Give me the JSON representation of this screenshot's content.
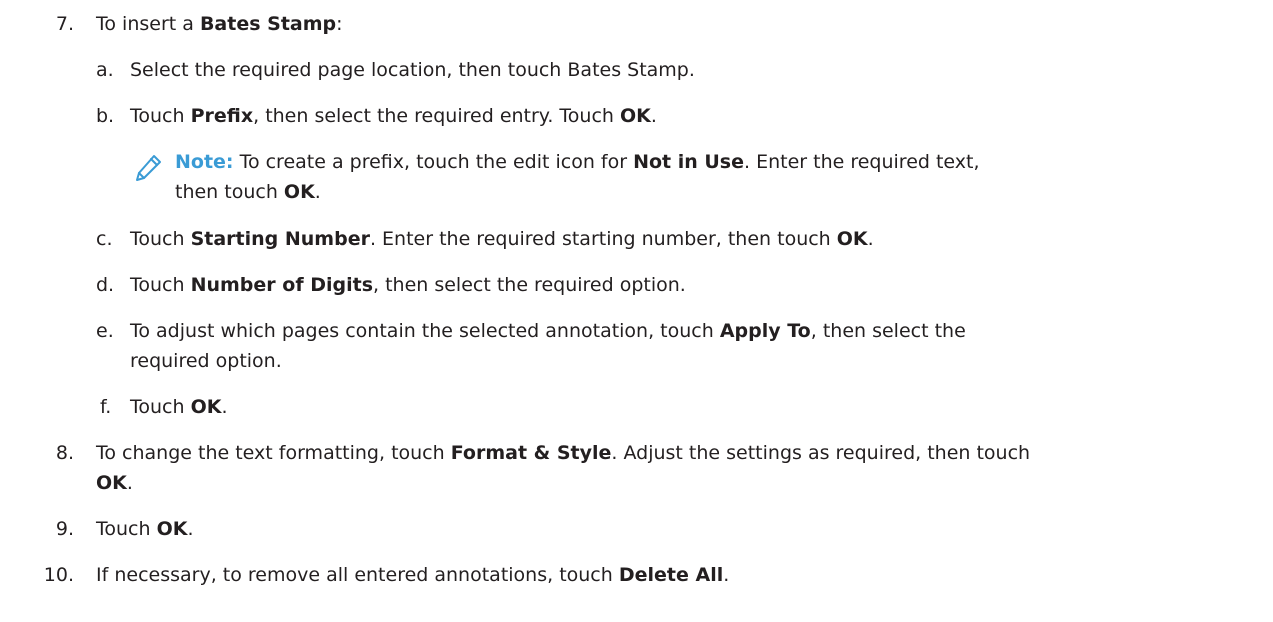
{
  "steps": [
    {
      "number": "7.",
      "text": [
        {
          "t": "To insert a ",
          "b": false
        },
        {
          "t": "Bates Stamp",
          "b": true
        },
        {
          "t": ":",
          "b": false
        }
      ],
      "substeps": [
        {
          "letter": "a.",
          "lines": [
            [
              {
                "t": "Select the required page location, then touch Bates Stamp.",
                "b": false
              }
            ]
          ]
        },
        {
          "letter": "b.",
          "lines": [
            [
              {
                "t": "Touch ",
                "b": false
              },
              {
                "t": "Prefix",
                "b": true
              },
              {
                "t": ", then select the required entry. Touch ",
                "b": false
              },
              {
                "t": "OK",
                "b": true
              },
              {
                "t": ".",
                "b": false
              }
            ]
          ],
          "note": {
            "icon": "pencil-icon",
            "label": "Note:",
            "lines": [
              [
                {
                  "t": " To create a prefix, touch the edit icon for ",
                  "b": false
                },
                {
                  "t": "Not in Use",
                  "b": true
                },
                {
                  "t": ". Enter the required text,",
                  "b": false
                }
              ],
              [
                {
                  "t": "then touch ",
                  "b": false
                },
                {
                  "t": "OK",
                  "b": true
                },
                {
                  "t": ".",
                  "b": false
                }
              ]
            ]
          }
        },
        {
          "letter": "c.",
          "lines": [
            [
              {
                "t": "Touch ",
                "b": false
              },
              {
                "t": "Starting Number",
                "b": true
              },
              {
                "t": ". Enter the required starting number, then touch ",
                "b": false
              },
              {
                "t": "OK",
                "b": true
              },
              {
                "t": ".",
                "b": false
              }
            ]
          ]
        },
        {
          "letter": "d.",
          "lines": [
            [
              {
                "t": "Touch ",
                "b": false
              },
              {
                "t": "Number of Digits",
                "b": true
              },
              {
                "t": ", then select the required option.",
                "b": false
              }
            ]
          ]
        },
        {
          "letter": "e.",
          "lines": [
            [
              {
                "t": "To adjust which pages contain the selected annotation, touch ",
                "b": false
              },
              {
                "t": "Apply To",
                "b": true
              },
              {
                "t": ", then select the",
                "b": false
              }
            ],
            [
              {
                "t": "required option.",
                "b": false
              }
            ]
          ]
        },
        {
          "letter": "f.",
          "lines": [
            [
              {
                "t": "Touch ",
                "b": false
              },
              {
                "t": "OK",
                "b": true
              },
              {
                "t": ".",
                "b": false
              }
            ]
          ]
        }
      ]
    },
    {
      "number": "8.",
      "lines": [
        [
          {
            "t": "To change the text formatting, touch ",
            "b": false
          },
          {
            "t": "Format & Style",
            "b": true
          },
          {
            "t": ". Adjust the settings as required, then touch",
            "b": false
          }
        ],
        [
          {
            "t": "OK",
            "b": true
          },
          {
            "t": ".",
            "b": false
          }
        ]
      ]
    },
    {
      "number": "9.",
      "lines": [
        [
          {
            "t": "Touch ",
            "b": false
          },
          {
            "t": "OK",
            "b": true
          },
          {
            "t": ".",
            "b": false
          }
        ]
      ]
    },
    {
      "number": "10.",
      "lines": [
        [
          {
            "t": "If necessary, to remove all entered annotations, touch ",
            "b": false
          },
          {
            "t": "Delete All",
            "b": true
          },
          {
            "t": ".",
            "b": false
          }
        ]
      ]
    }
  ],
  "colors": {
    "text": "#231f20",
    "note_accent": "#3a9bd5"
  }
}
